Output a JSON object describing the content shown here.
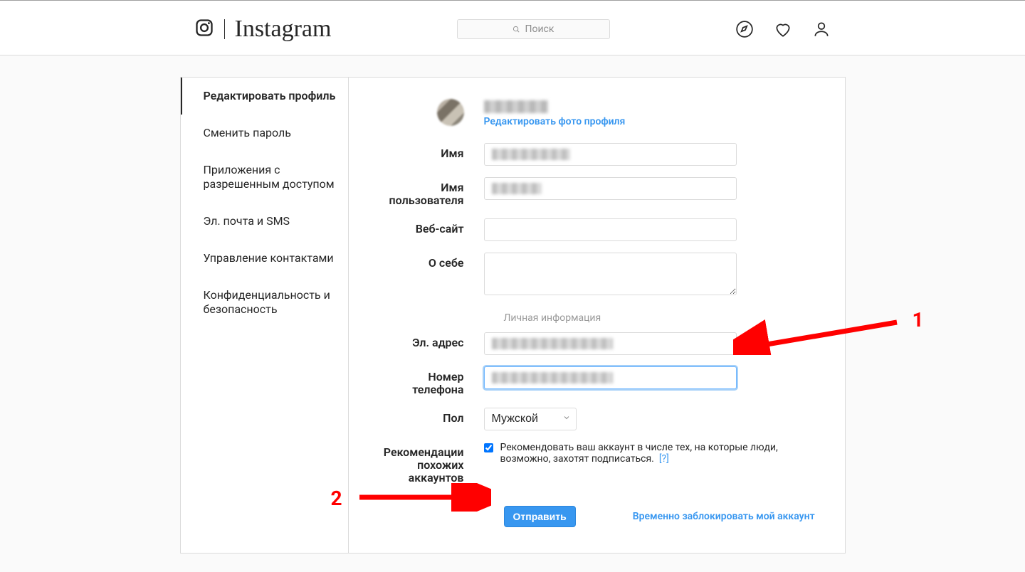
{
  "header": {
    "brand": "Instagram",
    "search_placeholder": "Поиск"
  },
  "sidebar": {
    "items": [
      {
        "label": "Редактировать профиль",
        "active": true
      },
      {
        "label": "Сменить пароль",
        "active": false
      },
      {
        "label": "Приложения с разрешенным доступом",
        "active": false
      },
      {
        "label": "Эл. почта и SMS",
        "active": false
      },
      {
        "label": "Управление контактами",
        "active": false
      },
      {
        "label": "Конфиденциальность и безопасность",
        "active": false
      }
    ]
  },
  "profile": {
    "edit_photo_label": "Редактировать фото профиля",
    "labels": {
      "name": "Имя",
      "username": "Имя пользователя",
      "website": "Веб-сайт",
      "bio": "О себе",
      "private_info": "Личная информация",
      "email": "Эл. адрес",
      "phone": "Номер телефона",
      "gender": "Пол",
      "similar": "Рекомендации похожих аккаунтов"
    },
    "values": {
      "website": "",
      "bio": "",
      "gender": "Мужской",
      "similar_checked": true,
      "similar_text": "Рекомендовать ваш аккаунт в числе тех, на которые люди, возможно, захотят подписаться.",
      "similar_help": "[?]"
    },
    "submit_label": "Отправить",
    "disable_link": "Временно заблокировать мой аккаунт"
  },
  "annotations": {
    "one": "1",
    "two": "2"
  }
}
